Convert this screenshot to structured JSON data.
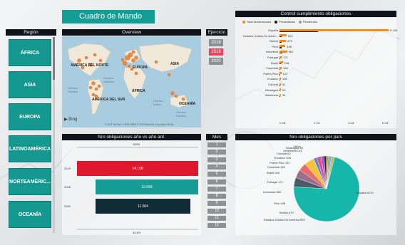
{
  "app": {
    "title": "Cuadro de Mando"
  },
  "region": {
    "header": "Región",
    "items": [
      "ÁFRICA",
      "ASIA",
      "EUROPA",
      "LATINOAMÉRICA",
      "NORTEAMÉRIC...",
      "OCEANÍA"
    ]
  },
  "map": {
    "header": "Overview",
    "continents": {
      "north_america": "AMÉRICA DEL NORTE",
      "europe": "EUROPA",
      "asia": "ASIA",
      "africa": "ÁFRICA",
      "south_america": "AMÉRICA DEL SUR",
      "oceania": "OCEANÍA"
    },
    "oceans": {
      "atlantic": "Océano\nAtlántico",
      "pacific": "Océano\nPacífico",
      "indian": "Océano\nÍndico",
      "pacific_south": "Océano\nPacífico"
    },
    "bing": "Bing",
    "credit": "© 2022 TomTom © 2023 HERE © 2023 Microsoft Corporation  Terms"
  },
  "ejercicio": {
    "header": "Ejercicio",
    "years": [
      "2018",
      "2019",
      "2020"
    ],
    "selected": "2019"
  },
  "mes": {
    "header": "Mes",
    "months": [
      "1",
      "2",
      "3",
      "4",
      "5",
      "6",
      "7",
      "8",
      "9",
      "10",
      "11",
      "12"
    ]
  },
  "control": {
    "header": "Control cumplimiento obligaciones",
    "legend": [
      "Total declaraciones",
      "Presentadas",
      "Pendientes"
    ],
    "colors": {
      "total": "#f28a24",
      "presentadas": "#1b1b1b",
      "pendientes": "#9a9a9a"
    },
    "countries": [
      "España",
      "Estados Unidos De Améri...",
      "Bolivia",
      "Perú",
      "Indonesia",
      "Portugal",
      "Brasil",
      "Colombia",
      "Puerto Rico",
      "Ecuador",
      "Canadá",
      "Nicaragua",
      "Venezuela"
    ],
    "values": [
      "8.130",
      "523",
      "479",
      "438",
      "562",
      "171",
      "248",
      "166",
      "137",
      "108",
      "62",
      "53",
      "34"
    ],
    "axis": [
      "0 mil",
      "2 mil",
      "4 mil",
      "6 mil"
    ]
  },
  "chart_data": [
    {
      "type": "bar",
      "title": "Nro obligaciones año vs año ant.",
      "categories": [
        "2018",
        "2019",
        "2020"
      ],
      "values": [
        12000,
        14158,
        11064
      ],
      "labels": [
        "12.093",
        "14.158",
        "11.064"
      ],
      "top_annotation": "100%",
      "bottom_annotation": "42,8%",
      "colors": [
        "#169c94",
        "#e0182e",
        "#102a36"
      ]
    },
    {
      "type": "pie",
      "title": "Nro obligaciones por país",
      "slices": [
        {
          "label": "España 8170",
          "value": 8170,
          "color": "#16b6aa"
        },
        {
          "label": "Estados Unidos De América 523",
          "value": 523,
          "color": "#4a5a66"
        },
        {
          "label": "Bolivia 479",
          "value": 479,
          "color": "#9b6f8c"
        },
        {
          "label": "Perú 438",
          "value": 438,
          "color": "#e86a6a"
        },
        {
          "label": "Indonesia 562",
          "value": 562,
          "color": "#f5c142"
        },
        {
          "label": "Portugal 171",
          "value": 171,
          "color": "#4a86c8"
        },
        {
          "label": "Brasil 248",
          "value": 248,
          "color": "#e84a9a"
        },
        {
          "label": "Colombia 166",
          "value": 166,
          "color": "#8e5ac8"
        },
        {
          "label": "Puerto Rico 137",
          "value": 137,
          "color": "#1a2a3a"
        },
        {
          "label": "Ecuador 108",
          "value": 108,
          "color": "#f28a24"
        },
        {
          "label": "Canadá 62",
          "value": 62,
          "color": "#3a8a6a"
        },
        {
          "label": "Venezuela 124",
          "value": 124,
          "color": "#6ab0e0"
        },
        {
          "label": "Nicaragua 48",
          "value": 48,
          "color": "#c84a4a"
        },
        {
          "label": "Otros",
          "value": 120,
          "color": "#b0c040"
        }
      ]
    }
  ]
}
